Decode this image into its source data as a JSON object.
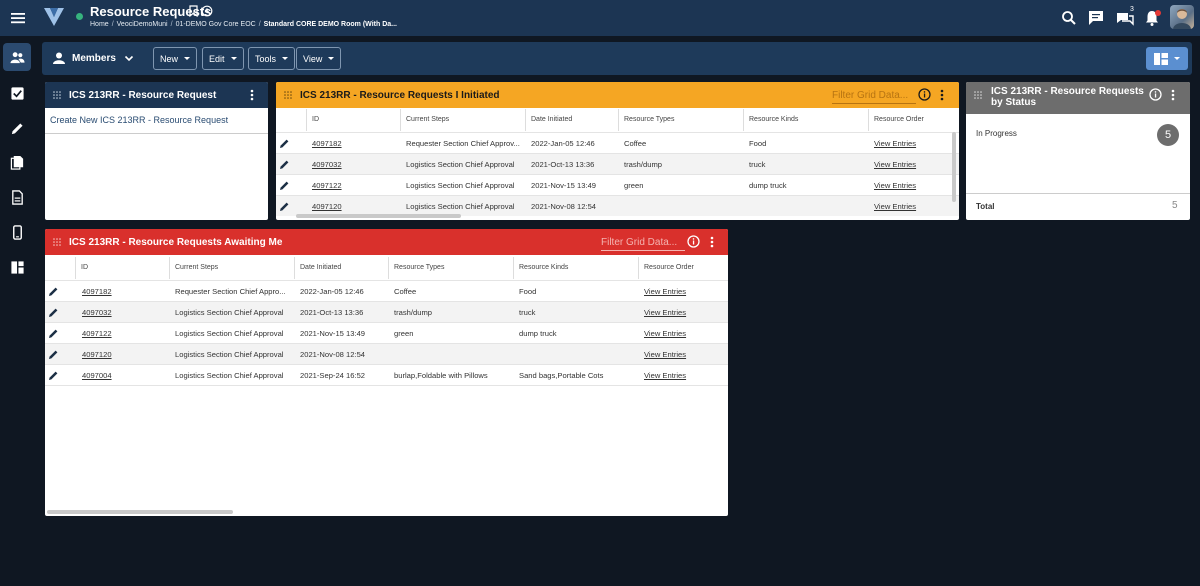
{
  "header": {
    "title": "Resource Requests",
    "breadcrumb": [
      "Home",
      "VeociDemoMuni",
      "01-DEMO Gov Core EOC",
      "Standard CORE DEMO Room (With Da..."
    ],
    "chat_badge": "3"
  },
  "toolbar": {
    "members_label": "Members",
    "new_label": "New",
    "edit_label": "Edit",
    "tools_label": "Tools",
    "view_label": "View"
  },
  "panel_create": {
    "title": "ICS 213RR - Resource Request",
    "link": "Create New ICS 213RR - Resource Request"
  },
  "panel_initiated": {
    "title": "ICS 213RR - Resource Requests I Initiated",
    "filter_placeholder": "Filter Grid Data...",
    "columns": [
      "ID",
      "Current Steps",
      "Date Initiated",
      "Resource Types",
      "Resource Kinds",
      "Resource Order"
    ],
    "rows": [
      {
        "id": "4097182",
        "step": "Requester Section Chief Approv...",
        "date": "2022-Jan-05 12:46",
        "type": "Coffee",
        "kind": "Food",
        "order": "View Entries"
      },
      {
        "id": "4097032",
        "step": "Logistics Section Chief Approval",
        "date": "2021-Oct-13 13:36",
        "type": "trash/dump",
        "kind": "truck",
        "order": "View Entries"
      },
      {
        "id": "4097122",
        "step": "Logistics Section Chief Approval",
        "date": "2021-Nov-15 13:49",
        "type": "green",
        "kind": "dump truck",
        "order": "View Entries"
      },
      {
        "id": "4097120",
        "step": "Logistics Section Chief Approval",
        "date": "2021-Nov-08 12:54",
        "type": "",
        "kind": "",
        "order": "View Entries"
      }
    ]
  },
  "panel_status": {
    "title_line1": "ICS 213RR - Resource Requests",
    "title_line2": "by Status",
    "status_label": "In Progress",
    "status_count": "5",
    "total_label": "Total",
    "total_value": "5"
  },
  "panel_awaiting": {
    "title": "ICS 213RR - Resource Requests Awaiting Me",
    "filter_placeholder": "Filter Grid Data...",
    "columns": [
      "ID",
      "Current Steps",
      "Date Initiated",
      "Resource Types",
      "Resource Kinds",
      "Resource Order"
    ],
    "rows": [
      {
        "id": "4097182",
        "step": "Requester Section Chief Appro...",
        "date": "2022-Jan-05 12:46",
        "type": "Coffee",
        "kind": "Food",
        "order": "View Entries"
      },
      {
        "id": "4097032",
        "step": "Logistics Section Chief Approval",
        "date": "2021-Oct-13 13:36",
        "type": "trash/dump",
        "kind": "truck",
        "order": "View Entries"
      },
      {
        "id": "4097122",
        "step": "Logistics Section Chief Approval",
        "date": "2021-Nov-15 13:49",
        "type": "green",
        "kind": "dump truck",
        "order": "View Entries"
      },
      {
        "id": "4097120",
        "step": "Logistics Section Chief Approval",
        "date": "2021-Nov-08 12:54",
        "type": "",
        "kind": "",
        "order": "View Entries"
      },
      {
        "id": "4097004",
        "step": "Logistics Section Chief Approval",
        "date": "2021-Sep-24 16:52",
        "type": "burlap,Foldable with Pillows",
        "kind": "Sand bags,Portable Cots",
        "order": "View Entries"
      }
    ]
  },
  "colors": {
    "topbar": "#1c3553",
    "initiated_header": "#f5a623",
    "awaiting_header": "#d9302c",
    "status_header": "#6d6d6d",
    "create_header": "#1c3553"
  }
}
